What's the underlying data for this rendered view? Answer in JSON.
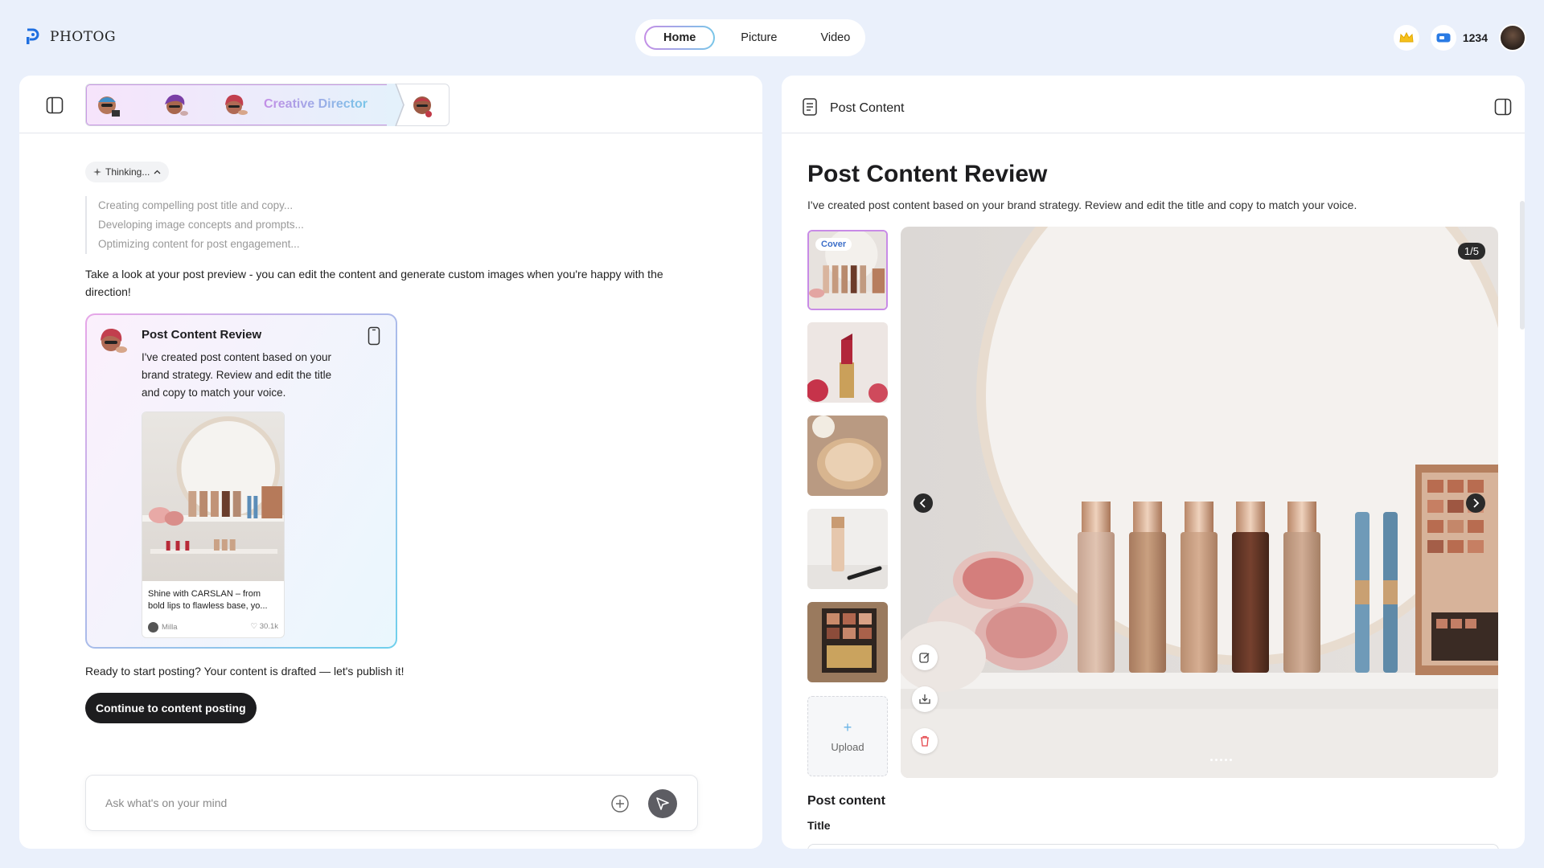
{
  "app": {
    "logo_text": "PHOTOG"
  },
  "nav": {
    "tabs": [
      {
        "label": "Home",
        "active": true
      },
      {
        "label": "Picture"
      },
      {
        "label": "Video"
      }
    ]
  },
  "header": {
    "credits": "1234"
  },
  "agents": {
    "active_name": "Creative Director"
  },
  "chat": {
    "thinking_label": "Thinking...",
    "steps": [
      "Creating compelling post title and copy...",
      "Developing image concepts and prompts...",
      "Optimizing content for post engagement..."
    ],
    "message1": "Take a look at your post preview - you can edit the content and generate custom images when you're happy with the direction!",
    "card": {
      "title": "Post Content Review",
      "text": "I've created post content based on your brand strategy. Review and edit the title and copy to match your voice.",
      "preview_caption": "Shine with CARSLAN – from bold lips to flawless base, yo...",
      "preview_user": "Milla",
      "preview_likes": "30.1k"
    },
    "message2": "Ready to start posting? Your content is drafted — let's publish it!",
    "cta_label": "Continue to content posting",
    "input_placeholder": "Ask what's on your mind"
  },
  "right_panel": {
    "header_title": "Post Content",
    "review_title": "Post Content Review",
    "review_subtitle": "I've created post content based on your brand strategy. Review and edit the title and copy to match your voice.",
    "cover_badge": "Cover",
    "upload_label": "Upload",
    "page_indicator": "1/5",
    "section_label": "Post content",
    "title_label": "Title"
  },
  "icons": [
    "logo-icon",
    "crown-icon",
    "credit-icon",
    "sidebar-toggle-icon",
    "sparkle-icon",
    "chevron-up-icon",
    "phone-icon",
    "plus-circle-icon",
    "send-icon",
    "document-icon",
    "panel-collapse-icon",
    "chevron-left-icon",
    "chevron-right-icon",
    "edit-icon",
    "download-icon",
    "trash-icon"
  ],
  "colors": {
    "accent_purple": "#c48ee6",
    "accent_blue": "#79c6e8",
    "background": "#eaf0fb",
    "dark_button": "#1d1d1f",
    "delete_red": "#e5484d"
  }
}
